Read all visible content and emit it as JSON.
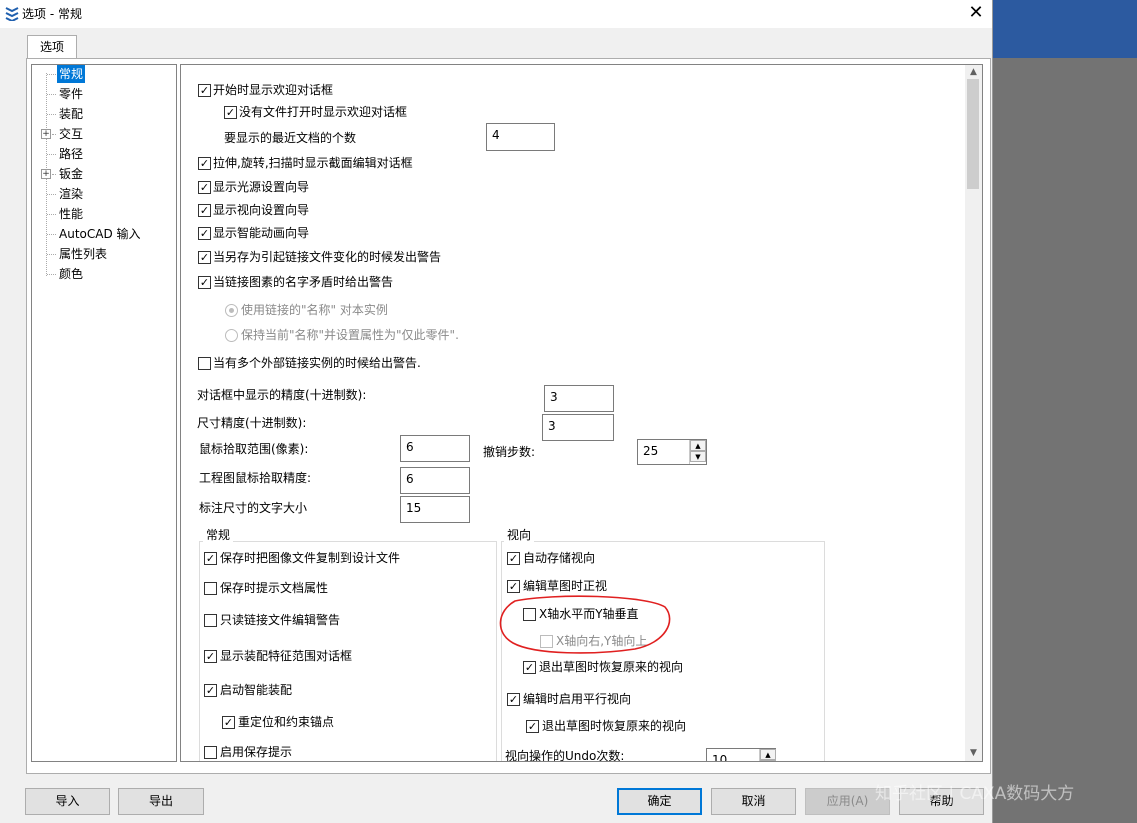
{
  "window": {
    "title": "选项 - 常规",
    "close_glyph": "✕",
    "tab_label": "选项"
  },
  "tree": {
    "items": [
      {
        "label": "常规",
        "selected": true
      },
      {
        "label": "零件"
      },
      {
        "label": "装配"
      },
      {
        "label": "交互",
        "expandable": true
      },
      {
        "label": "路径"
      },
      {
        "label": "钣金",
        "expandable": true
      },
      {
        "label": "渲染"
      },
      {
        "label": "性能"
      },
      {
        "label": "AutoCAD 输入"
      },
      {
        "label": "属性列表"
      },
      {
        "label": "颜色"
      }
    ],
    "expander_glyph": "+"
  },
  "general": {
    "show_welcome": {
      "label": "开始时显示欢迎对话框",
      "checked": true
    },
    "show_welcome_no_file": {
      "label": "没有文件打开时显示欢迎对话框",
      "checked": true
    },
    "recent_docs_label": "要显示的最近文档的个数",
    "recent_docs_value": "4",
    "show_section_edit": {
      "label": "拉伸,旋转,扫描时显示截面编辑对话框",
      "checked": true
    },
    "show_light_wizard": {
      "label": "显示光源设置向导",
      "checked": true
    },
    "show_view_wizard": {
      "label": "显示视向设置向导",
      "checked": true
    },
    "show_smart_anim_wizard": {
      "label": "显示智能动画向导",
      "checked": true
    },
    "warn_saveas_links": {
      "label": "当另存为引起链接文件变化的时候发出警告",
      "checked": true
    },
    "warn_link_name_conflict": {
      "label": "当链接图素的名字矛盾时给出警告",
      "checked": true
    },
    "radio_use_link_name": {
      "label": "使用链接的\"名称\" 对本实例",
      "selected": true
    },
    "radio_keep_name": {
      "label": "保持当前\"名称\"并设置属性为\"仅此零件\".",
      "selected": false
    },
    "warn_multi_external": {
      "label": "当有多个外部链接实例的时候给出警告.",
      "checked": false
    },
    "dialog_precision_label": "对话框中显示的精度(十进制数):",
    "dialog_precision_value": "3",
    "dim_precision_label": "尺寸精度(十进制数):",
    "dim_precision_value": "3",
    "pick_range_label": "鼠标拾取范围(像素):",
    "pick_range_value": "6",
    "undo_steps_label": "撤销步数:",
    "undo_steps_value": "25",
    "drawing_pick_label": "工程图鼠标拾取精度:",
    "drawing_pick_value": "6",
    "dim_text_size_label": "标注尺寸的文字大小",
    "dim_text_size_value": "15"
  },
  "group_general": {
    "title": "常规",
    "copy_image_on_save": {
      "label": "保存时把图像文件复制到设计文件",
      "checked": true
    },
    "prompt_doc_props": {
      "label": "保存时提示文档属性",
      "checked": false
    },
    "readonly_link_warning": {
      "label": "只读链接文件编辑警告",
      "checked": false
    },
    "show_assembly_feature_range": {
      "label": "显示装配特征范围对话框",
      "checked": true
    },
    "smart_assembly": {
      "label": "启动智能装配",
      "checked": true
    },
    "reposition_anchor": {
      "label": "重定位和约束锚点",
      "checked": true
    },
    "enable_save_prompt": {
      "label": "启用保存提示",
      "checked": false
    }
  },
  "group_view": {
    "title": "视向",
    "auto_store_view": {
      "label": "自动存储视向",
      "checked": true
    },
    "normal_view_on_sketch_edit": {
      "label": "编辑草图时正视",
      "checked": true
    },
    "x_horizontal_y_vertical": {
      "label": "X轴水平而Y轴垂直",
      "checked": false
    },
    "x_right_y_up": {
      "label": "X轴向右,Y轴向上",
      "checked": false
    },
    "restore_view_on_exit_1": {
      "label": "退出草图时恢复原来的视向",
      "checked": true
    },
    "parallel_view_on_edit": {
      "label": "编辑时启用平行视向",
      "checked": true
    },
    "restore_view_on_exit_2": {
      "label": "退出草图时恢复原来的视向",
      "checked": true
    },
    "undo_count_label": "视向操作的Undo次数:",
    "undo_count_value": "10"
  },
  "buttons": {
    "import": "导入",
    "export": "导出",
    "ok": "确定",
    "cancel": "取消",
    "apply": "应用(A)",
    "help": "帮助"
  },
  "check_glyph": "✓",
  "watermark": "知乎社区 | CAXA数码大方",
  "colors": {
    "annotation_circle": "#e02020",
    "selection": "#0078d7",
    "title_accent": "#2c5aa0"
  }
}
